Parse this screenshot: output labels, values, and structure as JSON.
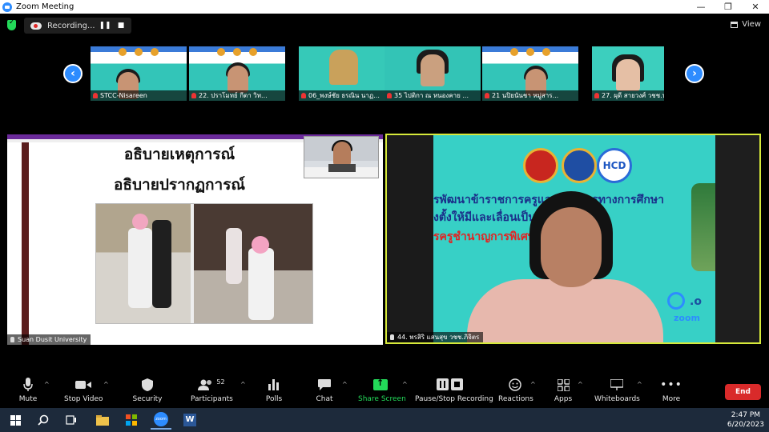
{
  "window": {
    "title": "Zoom Meeting",
    "minimize": "—",
    "maximize": "❐",
    "close": "✕"
  },
  "topbar": {
    "recording_label": "Recording...",
    "view_label": "View"
  },
  "thumbnails": [
    {
      "name": "STCC-Nisareen"
    },
    {
      "name": "22. ปราโมทย์  กีตา  วิท..."
    },
    {
      "name": "06_พงษ์ชัย ธรณิน นาฏ..."
    },
    {
      "name": "35 ไปติกา ณ หนองคาย ..."
    },
    {
      "name": "21 นปิยนันชา หมู่สาร..."
    },
    {
      "name": "27. ผุดี สายวงศ์ วชช.น..."
    }
  ],
  "shared_screen": {
    "title_line1": "อธิบายเหตุการณ์",
    "title_line2": "อธิบายปรากฏการณ์",
    "name_tag": "Suan Dusit University"
  },
  "speaker": {
    "banner_line1": "รพัฒนาข้าราชการครูและบุคลากรทางการศึกษา",
    "banner_line2": "งตั้งให้มีและเลื่อนเป็นวิ",
    "banner_line3": "รครูชำนาญการพิเศษ",
    "hcd_logo": "HCD",
    "dot_o": ".o",
    "zoom_word": "zoom",
    "name_tag": "44. พรสิริ แสนสุข วชช.ภิจิตร"
  },
  "toolbar": {
    "mute": "Mute",
    "stop_video": "Stop Video",
    "security": "Security",
    "participants": "Participants",
    "participants_count": "52",
    "polls": "Polls",
    "chat": "Chat",
    "share_screen": "Share Screen",
    "pause_stop_recording": "Pause/Stop Recording",
    "reactions": "Reactions",
    "apps": "Apps",
    "whiteboards": "Whiteboards",
    "more": "More",
    "end": "End"
  },
  "taskbar": {
    "time": "2:47 PM",
    "date": "6/20/2023"
  },
  "colors": {
    "zoom_blue": "#2D8CFF",
    "end_red": "#d92a2a",
    "share_green": "#23D959",
    "active_border": "#d6e93a"
  }
}
